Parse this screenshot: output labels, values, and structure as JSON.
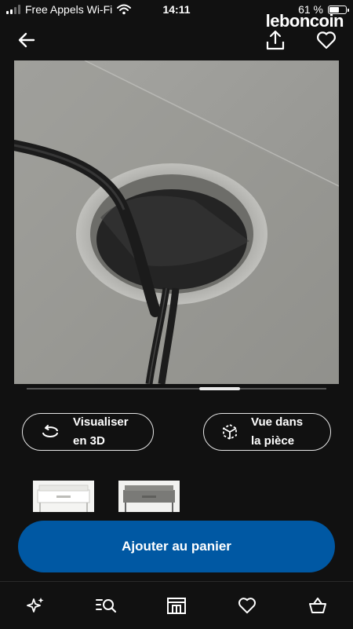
{
  "status_bar": {
    "carrier": "Free Appels Wi-Fi",
    "time": "14:11",
    "battery": "61 %",
    "battery_level": 0.61,
    "signal_bars": 2,
    "app_logo": "leboncoin"
  },
  "nav": {
    "back_icon": "arrow-left-icon",
    "share_icon": "share-icon",
    "favorite_icon": "heart-icon"
  },
  "gallery": {
    "image_subject": "desk cable management hole with black cable",
    "current_page": 5,
    "page_count": 7
  },
  "actions": {
    "view_3d_label": "Visualiser\nen 3D",
    "view_in_room_label": "Vue dans\nla pièce"
  },
  "variants": [
    {
      "color": "#f4f4f2"
    },
    {
      "color": "#6e6e6c"
    }
  ],
  "cart": {
    "add_label": "Ajouter au panier",
    "color": "#0058a3"
  },
  "tabbar": {
    "items": [
      {
        "icon": "sparkle-icon"
      },
      {
        "icon": "search-list-icon"
      },
      {
        "icon": "store-icon"
      },
      {
        "icon": "heart-icon"
      },
      {
        "icon": "basket-icon"
      }
    ]
  }
}
